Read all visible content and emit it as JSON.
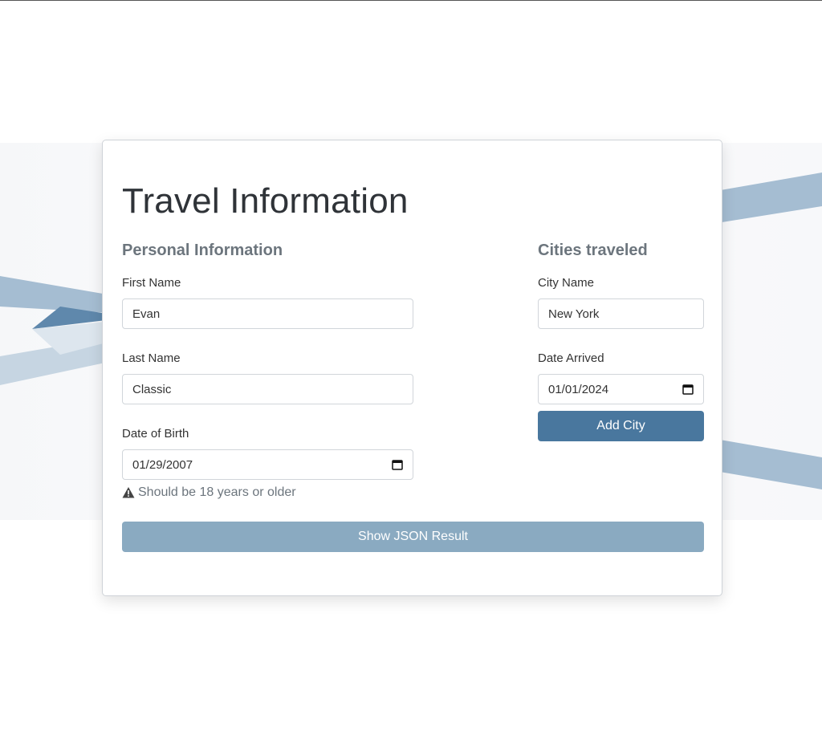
{
  "form": {
    "title": "Travel Information",
    "personal": {
      "heading": "Personal Information",
      "first_name_label": "First Name",
      "first_name_value": "Evan",
      "last_name_label": "Last Name",
      "last_name_value": "Classic",
      "dob_label": "Date of Birth",
      "dob_value": "01/29/2007",
      "dob_hint": "Should be 18 years or older"
    },
    "cities": {
      "heading": "Cities traveled",
      "city_name_label": "City Name",
      "city_name_value": "New York",
      "date_arrived_label": "Date Arrived",
      "date_arrived_value": "01/01/2024",
      "add_button": "Add City"
    },
    "json_button": "Show JSON Result"
  },
  "icons": {
    "hint_icon": "warning-triangle-icon",
    "date_icon": "calendar-icon"
  },
  "colors": {
    "primary": "#49779e",
    "primary_disabled": "#8aaac1",
    "heading_muted": "#6c757d",
    "background_stripe": "#a5bdd2"
  }
}
